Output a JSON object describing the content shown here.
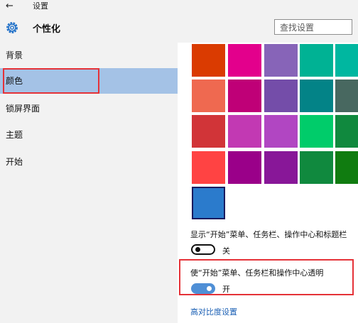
{
  "window": {
    "back_glyph": "←",
    "app_title": "设置"
  },
  "header": {
    "title": "个性化",
    "search_placeholder": "查找设置"
  },
  "sidebar": {
    "items": [
      {
        "label": "背景",
        "selected": false
      },
      {
        "label": "颜色",
        "selected": true
      },
      {
        "label": "锁屏界面",
        "selected": false
      },
      {
        "label": "主题",
        "selected": false
      },
      {
        "label": "开始",
        "selected": false
      }
    ]
  },
  "colors": {
    "swatches": [
      "#da3b01",
      "#e3008c",
      "#8764b8",
      "#00b294",
      "#00b7a0",
      "#ef6950",
      "#bf0077",
      "#744da9",
      "#038387",
      "#486860",
      "#d13438",
      "#c239b3",
      "#b146c2",
      "#00cc6a",
      "#10893e",
      "#ff4343",
      "#9a0089",
      "#881798",
      "#10893e",
      "#107c10",
      "#2b7bcc"
    ],
    "selected_index": 20
  },
  "settings": {
    "show_color_label": "显示“开始”菜单、任务栏、操作中心和标题栏",
    "show_color_state": "关",
    "transparent_label": "使“开始”菜单、任务栏和操作中心透明",
    "transparent_state": "开",
    "high_contrast_link": "高对比度设置"
  },
  "theme": {
    "accent": "#4f8fd6",
    "selection": "#a4c2e6",
    "highlight": "#e53238"
  }
}
